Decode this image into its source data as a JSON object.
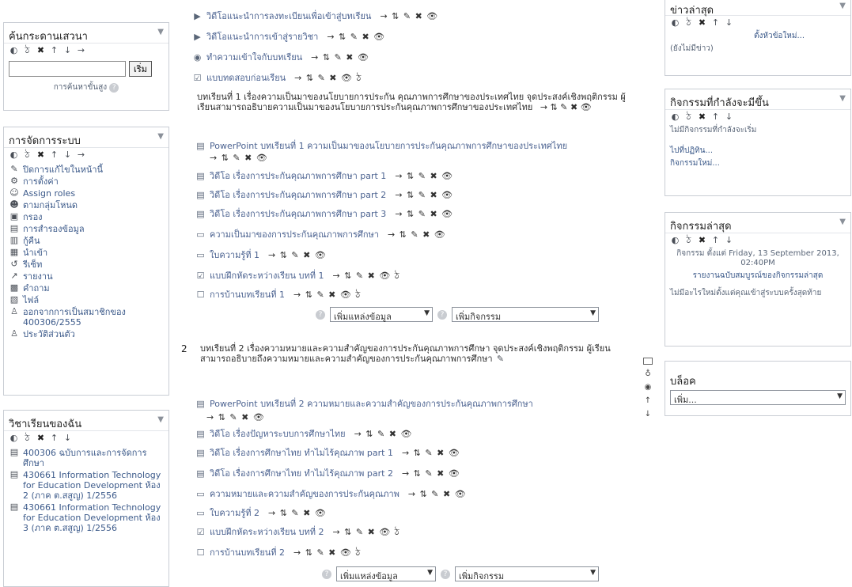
{
  "left_blocks": {
    "search": {
      "title": "ค้นกระดานเสวนา",
      "button": "เริ่ม",
      "advanced": "การค้นหาขั้นสูง"
    },
    "admin": {
      "title": "การจัดการระบบ",
      "items": [
        {
          "icon": "pencil-icon",
          "label": "ปิดการแก้ไขในหน้านี้"
        },
        {
          "icon": "settings-icon",
          "label": "การตั้งค่า"
        },
        {
          "icon": "users-icon",
          "label": "Assign roles"
        },
        {
          "icon": "group-icon",
          "label": "ตามกลุ่มโหนด"
        },
        {
          "icon": "backup-icon",
          "label": "กรอง"
        },
        {
          "icon": "restore-icon",
          "label": "การสำรองข้อมูล"
        },
        {
          "icon": "import-icon",
          "label": "กู้คืน"
        },
        {
          "icon": "import-icon",
          "label": "นำเข้า"
        },
        {
          "icon": "reset-icon",
          "label": "รีเซ็ท"
        },
        {
          "icon": "report-icon",
          "label": "รายงาน"
        },
        {
          "icon": "question-icon",
          "label": "คำถาม"
        },
        {
          "icon": "file-icon",
          "label": "ไฟล์"
        },
        {
          "icon": "unenrol-icon",
          "label": "ออกจากการเป็นสมาชิกของ 400306/2555"
        },
        {
          "icon": "profile-icon",
          "label": "ประวัติส่วนตัว"
        }
      ]
    },
    "courses": {
      "title": "วิชาเรียนของฉัน",
      "items": [
        {
          "label": "400306 ฉบับการและการจัดการศึกษา"
        },
        {
          "label": "430661 Information Technology for Education Development ห้อง 2 (ภาค ต.สสูญ) 1/2556"
        },
        {
          "label": "430661 Information Technology for Education Development ห้อง 3 (ภาค ต.สสูญ) 1/2556"
        }
      ]
    }
  },
  "main": {
    "top_activities": [
      "วิดีโอแนะนำการลงทะเบียนเพื่อเข้าสู่บทเรียน",
      "วิดีโอแนะนำการเข้าสู่รายวิชา",
      "ทำความเข้าใจกับบทเรียน",
      "แบบทดสอบก่อนเรียน"
    ],
    "section1_intro": "บทเรียนที่ 1 เรื่องความเป็นมาของนโยบายการประกัน คุณภาพการศึกษาของประเทศไทย จุดประสงค์เชิงพฤติกรรม ผู้เรียนสามารถอธิบายความเป็นมาของนโยบายการประกันคุณภาพการศึกษาของประเทศไทย",
    "section1_items": [
      "PowerPoint บทเรียนที่ 1 ความเป็นมาของนโยบายการประกันคุณภาพการศึกษาของประเทศไทย",
      "วิดีโอ เรื่องการประกันคุณภาพการศึกษา part 1",
      "วิดีโอ เรื่องการประกันคุณภาพการศึกษา part 2",
      "วิดีโอ เรื่องการประกันคุณภาพการศึกษา part 3",
      "ความเป็นมาของการประกันคุณภาพการศึกษา",
      "ใบความรู้ที่ 1",
      "แบบฝึกหัดระหว่างเรียน บทที่ 1",
      "การบ้านบทเรียนที่ 1"
    ],
    "add_resource": "เพิ่มแหล่งข้อมูล",
    "add_activity": "เพิ่มกิจกรรม",
    "section2_number": "2",
    "section2_intro": "บทเรียนที่ 2 เรื่องความหมายและความสำคัญของการประกันคุณภาพการศึกษา จุดประสงค์เชิงพฤติกรรม ผู้เรียนสามารถอธิบายถึงความหมายและความสำคัญของการประกันคุณภาพการศึกษา",
    "section2_items": [
      "PowerPoint บทเรียนที่ 2 ความหมายและความสำคัญของการประกันคุณภาพการศึกษา",
      "วิดีโอ เรื่องปัญหาระบบการศึกษาไทย",
      "วิดีโอ เรื่องการศึกษาไทย ทำไมไร้คุณภาพ part 1",
      "วิดีโอ เรื่องการศึกษาไทย ทำไมไร้คุณภาพ part 2",
      "ความหมายและความสำคัญของการประกันคุณภาพ",
      "ใบความรู้ที่ 2",
      "แบบฝึกหัดระหว่างเรียน บทที่ 2",
      "การบ้านบทเรียนที่ 2"
    ]
  },
  "right_blocks": {
    "news": {
      "title": "ข่าวล่าสุด",
      "add_topic": "ตั้งหัวข้อใหม่...",
      "none": "(ยังไม่มีข่าว)"
    },
    "upcoming": {
      "title": "กิจกรรมที่กำลังจะมีขึ้น",
      "none": "ไม่มีกิจกรรมที่กำลังจะเริ่ม",
      "goto": "ไปที่ปฏิทิน...",
      "new_event": "กิจกรรมใหม่..."
    },
    "recent": {
      "title": "กิจกรรมล่าสุด",
      "since": "กิจกรรม ตั้งแต่ Friday, 13 September 2013, 02:40PM",
      "full_report": "รายงานฉบับสมบูรณ์ของกิจกรรมล่าสุด",
      "nothing": "ไม่มีอะไรใหม่ตั้งแต่คุณเข้าสู่ระบบครั้งสุดท้าย"
    },
    "blocks": {
      "title": "บล็อค",
      "select": "เพิ่ม..."
    }
  },
  "tools": {
    "move_arrow": "→",
    "move_updown": "⇅",
    "edit": "✎",
    "delete": "✖",
    "visible": "👁",
    "group": "ঠ",
    "help": "?"
  }
}
